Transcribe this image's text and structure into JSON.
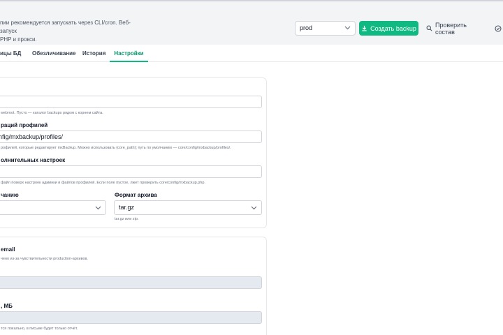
{
  "header": {
    "notice": "пии рекомендуется запускать через CLI/cron. Веб-запуск\nPHP и прокси.",
    "env_select_value": "prod",
    "create_backup_label": "Создать backup",
    "check_label": "Проверить состав"
  },
  "tabs": [
    {
      "label": "ицы БД"
    },
    {
      "label": "Обезличивание"
    },
    {
      "label": "История"
    },
    {
      "label": "Настройки"
    }
  ],
  "settings": {
    "field1_value": "",
    "field1_hint": "webroot. Пусто — каталог backups рядом с корнем сайта.",
    "profiles_label": "раций профилей",
    "profiles_value": "nfig/mxbackup/profiles/",
    "profiles_hint": "рофилей, которые редактирует mxBackup. Можно использовать {core_path}; путь по умолчанию — core/config/mxbackup/profiles/.",
    "extra_label": "олнительных настроек",
    "extra_value": "",
    "extra_hint": "файл поверх настроек админки и файлов профилей. Если поле пустое, лжет проверить core/config/mxbackup.php.",
    "default_label": "чанию",
    "default_value": "",
    "archive_label": "Формат архива",
    "archive_value": "tar.gz",
    "archive_hint": "tar.gz или zip."
  },
  "email_section": {
    "email_label": "email",
    "email_hint": "чено из-за чувствительности production-архивов.",
    "email_value": "",
    "size_label": ", МБ",
    "size_value": "",
    "size_hint": "тся локально, в письме будет только отчёт."
  }
}
